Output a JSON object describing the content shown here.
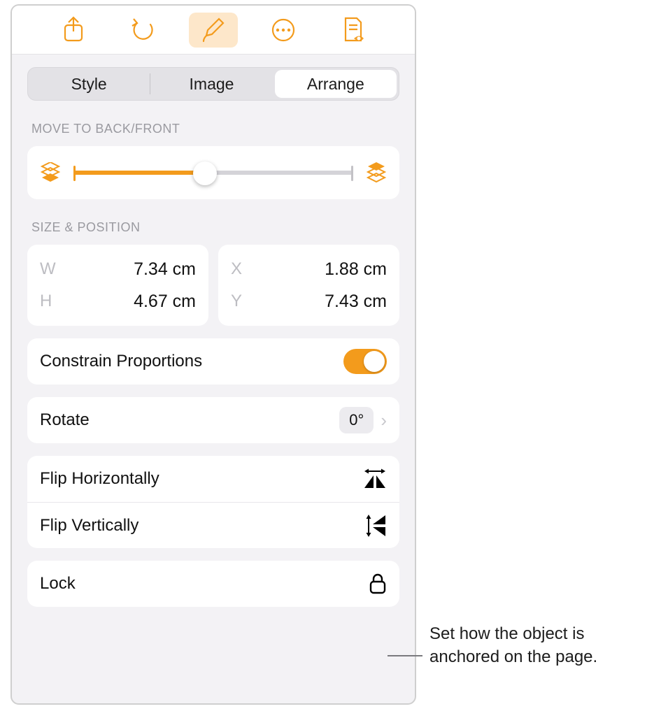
{
  "tabs": {
    "style": "Style",
    "image": "Image",
    "arrange": "Arrange"
  },
  "sections": {
    "layer_title": "MOVE TO BACK/FRONT",
    "size_title": "SIZE & POSITION"
  },
  "size": {
    "w_key": "W",
    "w_val": "7.34 cm",
    "h_key": "H",
    "h_val": "4.67 cm",
    "x_key": "X",
    "x_val": "1.88 cm",
    "y_key": "Y",
    "y_val": "7.43 cm"
  },
  "rows": {
    "constrain": "Constrain Proportions",
    "rotate": "Rotate",
    "rotate_val": "0°",
    "flip_h": "Flip Horizontally",
    "flip_v": "Flip Vertically",
    "lock": "Lock"
  },
  "callout": {
    "text": "Set how the object is anchored on the page."
  }
}
